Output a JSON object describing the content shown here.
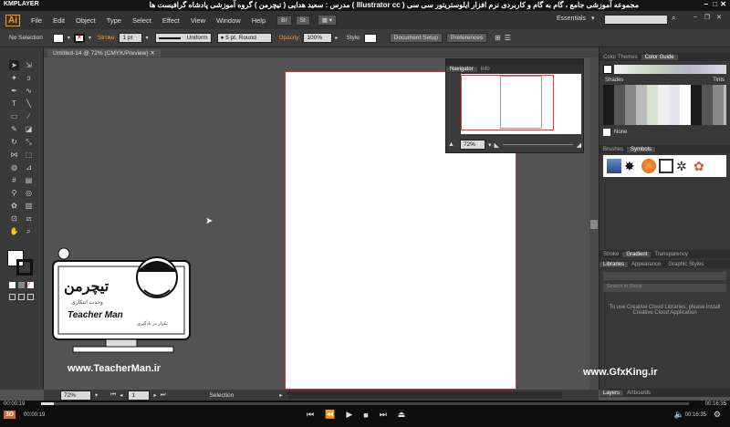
{
  "titlebar": {
    "app": "KMPLAYER",
    "title": "مجموعه آموزشی جامع ، گام به گام و کاربردی نرم افزار ایلوستریتور سی سی ( Illustrator cc ) مدرس : سعید هدایی ( تیچرمن ) گروه آموزشی پادشاه گرافیست ها"
  },
  "menubar": {
    "logo": "Ai",
    "items": [
      "File",
      "Edit",
      "Object",
      "Type",
      "Select",
      "Effect",
      "View",
      "Window",
      "Help"
    ],
    "br": "Br",
    "st": "St",
    "workspace": "Essentials",
    "search_placeholder": ""
  },
  "ctrlbar": {
    "selection": "No Selection",
    "stroke_label": "Stroke:",
    "stroke_value": "1 pt",
    "uniform": "Uniform",
    "brush": "5 pt. Round",
    "opacity_label": "Opacity:",
    "opacity_value": "100%",
    "style_label": "Style:",
    "doc_setup": "Document Setup",
    "preferences": "Preferences"
  },
  "doctab": {
    "label": "Untitled-14 @ 72% (CMYK/Preview)"
  },
  "navigator": {
    "tab1": "Navigator",
    "tab2": "Info",
    "zoom": "72%"
  },
  "panels": {
    "color_tabs": [
      "Color Themes",
      "Color Guide"
    ],
    "shades": "Shades",
    "tints": "Tints",
    "none": "None",
    "brush_tabs": [
      "Brushes",
      "Symbols"
    ],
    "stroke_tabs": [
      "Stroke",
      "Gradient",
      "Transparency"
    ],
    "lib_tabs": [
      "Libraries",
      "Appearance",
      "Graphic Styles"
    ],
    "lib_search": "Search in Stock",
    "lib_message": "To use Creative Cloud Libraries, please install Creative Cloud Application",
    "layers_tabs": [
      "Layers",
      "Artboards"
    ],
    "gfxking": "www.GfxKing.ir"
  },
  "teacher": {
    "brand_fa": "تیچرمن",
    "sub_fa": "وحدت ابتکاری",
    "brand_en": "Teacher Man",
    "tagline": "تکرار در یادگیری",
    "url": "www.TeacherMan.ir"
  },
  "statusbar": {
    "zoom": "72%",
    "page": "1",
    "mode": "Selection"
  },
  "player": {
    "elapsed": "00:00:19",
    "total": "00:16:35",
    "left_top": "00:00:19",
    "right_top": "00:16:35",
    "progress": 0.02,
    "badge": "3D"
  }
}
